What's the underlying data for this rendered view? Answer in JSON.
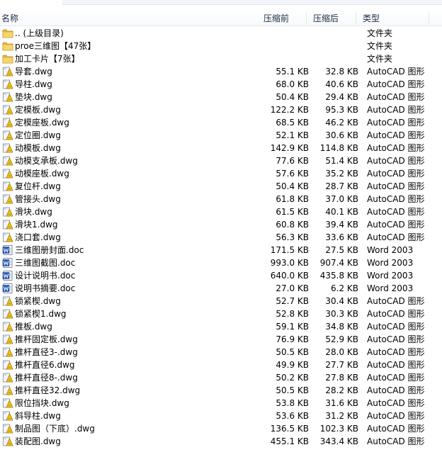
{
  "columns": {
    "name": "名称",
    "size": "压缩前",
    "packed": "压缩后",
    "type": "类型"
  },
  "files": [
    {
      "icon": "folder-icon",
      "name": ".. (上级目录)",
      "size": "",
      "packed": "",
      "type": "文件夹"
    },
    {
      "icon": "folder-icon",
      "name": "proe三维图【47张】",
      "size": "",
      "packed": "",
      "type": "文件夹"
    },
    {
      "icon": "folder-icon",
      "name": "加工卡片【7张】",
      "size": "",
      "packed": "",
      "type": "文件夹"
    },
    {
      "icon": "autocad-file-icon",
      "name": "导套.dwg",
      "size": "55.1 KB",
      "packed": "32.8 KB",
      "type": "AutoCAD 图形"
    },
    {
      "icon": "autocad-file-icon",
      "name": "导柱.dwg",
      "size": "68.0 KB",
      "packed": "40.6 KB",
      "type": "AutoCAD 图形"
    },
    {
      "icon": "autocad-file-icon",
      "name": "垫块.dwg",
      "size": "50.4 KB",
      "packed": "29.4 KB",
      "type": "AutoCAD 图形"
    },
    {
      "icon": "autocad-file-icon",
      "name": "定模板.dwg",
      "size": "122.2 KB",
      "packed": "95.3 KB",
      "type": "AutoCAD 图形"
    },
    {
      "icon": "autocad-file-icon",
      "name": "定模座板.dwg",
      "size": "68.5 KB",
      "packed": "46.2 KB",
      "type": "AutoCAD 图形"
    },
    {
      "icon": "autocad-file-icon",
      "name": "定位圈.dwg",
      "size": "52.1 KB",
      "packed": "30.6 KB",
      "type": "AutoCAD 图形"
    },
    {
      "icon": "autocad-file-icon",
      "name": "动模板.dwg",
      "size": "142.9 KB",
      "packed": "114.8 KB",
      "type": "AutoCAD 图形"
    },
    {
      "icon": "autocad-file-icon",
      "name": "动模支承板.dwg",
      "size": "77.6 KB",
      "packed": "51.4 KB",
      "type": "AutoCAD 图形"
    },
    {
      "icon": "autocad-file-icon",
      "name": "动模座板.dwg",
      "size": "57.6 KB",
      "packed": "35.2 KB",
      "type": "AutoCAD 图形"
    },
    {
      "icon": "autocad-file-icon",
      "name": "复位杆.dwg",
      "size": "50.4 KB",
      "packed": "28.7 KB",
      "type": "AutoCAD 图形"
    },
    {
      "icon": "autocad-file-icon",
      "name": "管接头.dwg",
      "size": "61.8 KB",
      "packed": "37.0 KB",
      "type": "AutoCAD 图形"
    },
    {
      "icon": "autocad-file-icon",
      "name": "滑块.dwg",
      "size": "61.5 KB",
      "packed": "40.1 KB",
      "type": "AutoCAD 图形"
    },
    {
      "icon": "autocad-file-icon",
      "name": "滑块1.dwg",
      "size": "60.8 KB",
      "packed": "39.4 KB",
      "type": "AutoCAD 图形"
    },
    {
      "icon": "autocad-file-icon",
      "name": "浇口套.dwg",
      "size": "56.3 KB",
      "packed": "33.6 KB",
      "type": "AutoCAD 图形"
    },
    {
      "icon": "word-file-icon",
      "name": "三维图册封面.doc",
      "size": "171.5 KB",
      "packed": "27.5 KB",
      "type": "Word 2003"
    },
    {
      "icon": "word-file-icon",
      "name": "三维图截图.doc",
      "size": "993.0 KB",
      "packed": "907.4 KB",
      "type": "Word 2003"
    },
    {
      "icon": "word-file-icon",
      "name": "设计说明书.doc",
      "size": "640.0 KB",
      "packed": "435.8 KB",
      "type": "Word 2003"
    },
    {
      "icon": "word-file-icon",
      "name": "说明书摘要.doc",
      "size": "27.0 KB",
      "packed": "6.2 KB",
      "type": "Word 2003"
    },
    {
      "icon": "autocad-file-icon",
      "name": "锁紧楔.dwg",
      "size": "52.7 KB",
      "packed": "30.4 KB",
      "type": "AutoCAD 图形"
    },
    {
      "icon": "autocad-file-icon",
      "name": "锁紧楔1.dwg",
      "size": "52.8 KB",
      "packed": "30.3 KB",
      "type": "AutoCAD 图形"
    },
    {
      "icon": "autocad-file-icon",
      "name": "推板.dwg",
      "size": "59.1 KB",
      "packed": "34.8 KB",
      "type": "AutoCAD 图形"
    },
    {
      "icon": "autocad-file-icon",
      "name": "推杆固定板.dwg",
      "size": "76.9 KB",
      "packed": "52.9 KB",
      "type": "AutoCAD 图形"
    },
    {
      "icon": "autocad-file-icon",
      "name": "推杆直径3-.dwg",
      "size": "50.5 KB",
      "packed": "28.0 KB",
      "type": "AutoCAD 图形"
    },
    {
      "icon": "autocad-file-icon",
      "name": "推杆直径6.dwg",
      "size": "49.9 KB",
      "packed": "27.7 KB",
      "type": "AutoCAD 图形"
    },
    {
      "icon": "autocad-file-icon",
      "name": "推杆直径8-.dwg",
      "size": "50.2 KB",
      "packed": "27.8 KB",
      "type": "AutoCAD 图形"
    },
    {
      "icon": "autocad-file-icon",
      "name": "推杆直径32.dwg",
      "size": "50.5 KB",
      "packed": "28.2 KB",
      "type": "AutoCAD 图形"
    },
    {
      "icon": "autocad-file-icon",
      "name": "限位挡块.dwg",
      "size": "53.8 KB",
      "packed": "31.6 KB",
      "type": "AutoCAD 图形"
    },
    {
      "icon": "autocad-file-icon",
      "name": "斜导柱.dwg",
      "size": "53.6 KB",
      "packed": "31.2 KB",
      "type": "AutoCAD 图形"
    },
    {
      "icon": "autocad-file-icon",
      "name": "制品图（下底）.dwg",
      "size": "136.5 KB",
      "packed": "102.3 KB",
      "type": "AutoCAD 图形"
    },
    {
      "icon": "autocad-file-icon",
      "name": "装配图.dwg",
      "size": "455.1 KB",
      "packed": "343.4 KB",
      "type": "AutoCAD 图形"
    }
  ]
}
